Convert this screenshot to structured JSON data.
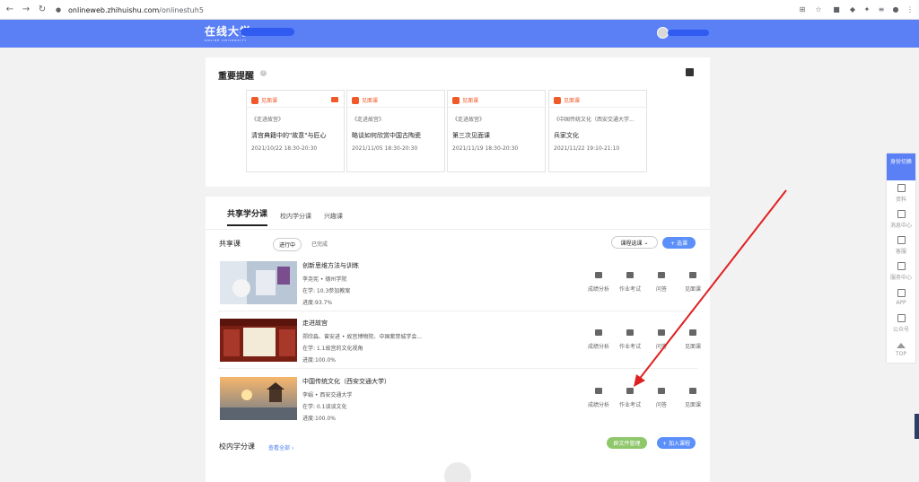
{
  "browser": {
    "url_host": "onlineweb.zhihuishu.com",
    "url_path": "/onlinestuh5"
  },
  "header": {
    "logo_text": "在线大学",
    "logo_sub": "ONLINE UNIVERSITY"
  },
  "reminder": {
    "title": "重要提醒",
    "cards": [
      {
        "type": "见面课",
        "course": "《走进故宫》",
        "title": "清宫典籍中的\"故意\"与匠心",
        "time": "2021/10/22 18:30-20:30",
        "has_video": true
      },
      {
        "type": "见面课",
        "course": "《走进故宫》",
        "title": "略谈如何欣赏中国古陶瓷",
        "time": "2021/11/05 18:30-20:30",
        "has_video": false
      },
      {
        "type": "见面课",
        "course": "《走进故宫》",
        "title": "第三次见面课",
        "time": "2021/11/19 18:30-20:30",
        "has_video": false
      },
      {
        "type": "见面课",
        "course": "《中国传统文化（西安交通大学...",
        "title": "兵家文化",
        "time": "2021/11/22 19:10-21:10",
        "has_video": false
      }
    ]
  },
  "courses": {
    "tabs": [
      "共享学分课",
      "校内学分课",
      "兴趣课"
    ],
    "section_label": "共享课",
    "filter_active": "进行中",
    "filter_done": "已完成",
    "select_label": "课程选课",
    "choose_btn": "+ 选课",
    "list": [
      {
        "title": "创新思维方法与训练",
        "teacher": "李尧宪 • 德州学院",
        "current": "在学: 10.3参加教案",
        "progress": "进度:93.7%"
      },
      {
        "title": "走进故宫",
        "teacher": "郑欣淼、曾安进 • 故宫博物院、中国紫禁城学会...",
        "current": "在学: 1.1故宫的文化视角",
        "progress": "进度:100.0%"
      },
      {
        "title": "中国传统文化（西安交通大学）",
        "teacher": "李娟 • 西安交通大学",
        "current": "在学: 0.1谈谈文化",
        "progress": "进度:100.0%"
      }
    ],
    "actions": [
      "成绩分析",
      "作业考试",
      "问答",
      "见面课"
    ],
    "campus_label": "校内学分课",
    "view_all": "查看全部 ›",
    "group_btn": "群文件管理",
    "add_course_btn": "+ 加入课程"
  },
  "sidebar": {
    "top": "身份切换",
    "items": [
      "资料",
      "消息中心",
      "客服",
      "服务中心",
      "APP",
      "公众号",
      "TOP"
    ]
  },
  "colors": {
    "brand": "#5b7ff5",
    "accent_orange": "#f05a28",
    "arrow": "#e02020"
  }
}
